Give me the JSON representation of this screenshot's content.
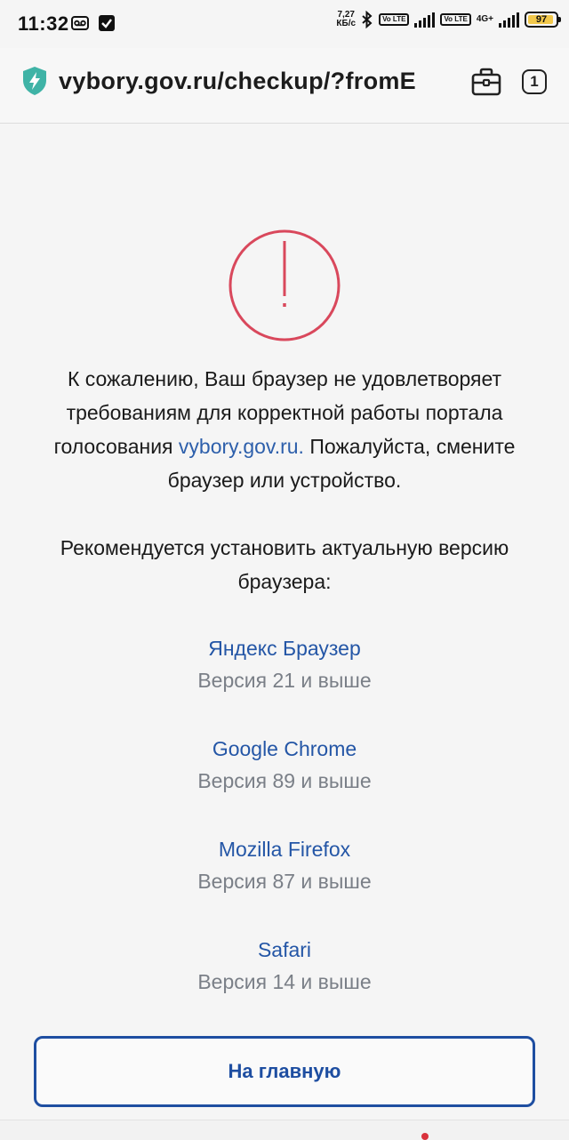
{
  "status_bar": {
    "time": "11:32",
    "speed_value": "7,27",
    "speed_unit": "КБ/с",
    "lte_tag_1": "Vo LTE",
    "lte_tag_2": "Vo LTE",
    "network_type": "4G+",
    "battery_percent": "97"
  },
  "browser_bar": {
    "url": "vybory.gov.ru/checkup/?fromE",
    "tab_count": "1"
  },
  "main": {
    "message_part1": "К сожалению, Ваш браузер не удовлетворяет требованиям для корректной работы портала голосования ",
    "message_link": "vybory.gov.ru.",
    "message_part2": " Пожалуйста, смените браузер или устройство.",
    "recommend_text": "Рекомендуется установить актуальную версию браузера:",
    "browsers": [
      {
        "name": "Яндекс Браузер",
        "version": "Версия 21 и выше"
      },
      {
        "name": "Google Chrome",
        "version": "Версия 89 и выше"
      },
      {
        "name": "Mozilla Firefox",
        "version": "Версия 87 и выше"
      },
      {
        "name": "Safari",
        "version": "Версия 14 и выше"
      }
    ],
    "home_button_label": "На главную"
  },
  "colors": {
    "alert_red": "#d9485c",
    "link_blue": "#2456a6",
    "button_blue": "#1e4ea1",
    "shield_teal": "#3fb3a6"
  }
}
